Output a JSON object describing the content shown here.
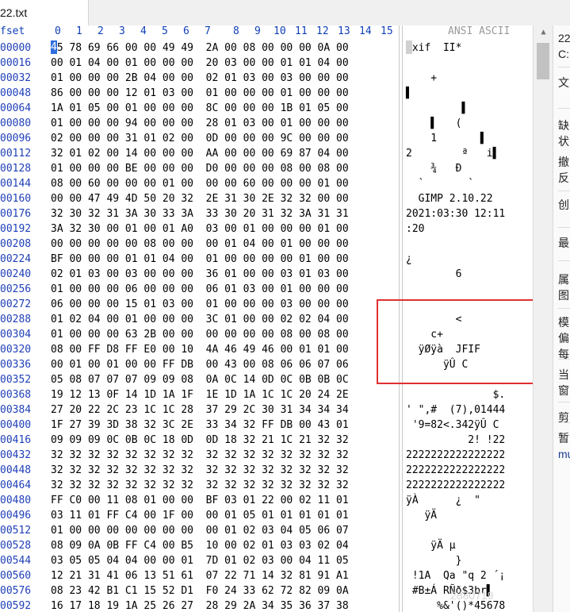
{
  "tab": {
    "title": "22.txt"
  },
  "header": {
    "offset_label": "fset",
    "columns": [
      "0",
      "1",
      "2",
      "3",
      "4",
      "5",
      "6",
      "7",
      "8",
      "9",
      "10",
      "11",
      "12",
      "13",
      "14",
      "15"
    ],
    "ascii_label": "ANSI ASCII"
  },
  "cursor": {
    "hex_digit": "4"
  },
  "rows": [
    {
      "offset": "00000",
      "bytes": "45 78 69 66 00 00 49 49  2A 00 08 00 00 00 0A 00",
      "ascii": "Exif  II*"
    },
    {
      "offset": "00016",
      "bytes": "00 01 04 00 01 00 00 00  20 03 00 00 01 01 04 00",
      "ascii": ""
    },
    {
      "offset": "00032",
      "bytes": "01 00 00 00 2B 04 00 00  02 01 03 00 03 00 00 00",
      "ascii": "    +"
    },
    {
      "offset": "00048",
      "bytes": "86 00 00 00 12 01 03 00  01 00 00 00 01 00 00 00",
      "ascii": "▌"
    },
    {
      "offset": "00064",
      "bytes": "1A 01 05 00 01 00 00 00  8C 00 00 00 1B 01 05 00",
      "ascii": "         ▌"
    },
    {
      "offset": "00080",
      "bytes": "01 00 00 00 94 00 00 00  28 01 03 00 01 00 00 00",
      "ascii": "    ▌   ("
    },
    {
      "offset": "00096",
      "bytes": "02 00 00 00 31 01 02 00  0D 00 00 00 9C 00 00 00",
      "ascii": "    1       ▌"
    },
    {
      "offset": "00112",
      "bytes": "32 01 02 00 14 00 00 00  AA 00 00 00 69 87 04 00",
      "ascii": "2        ª   i▌"
    },
    {
      "offset": "00128",
      "bytes": "01 00 00 00 BE 00 00 00  D0 00 00 00 08 00 08 00",
      "ascii": "    ¾   Ð"
    },
    {
      "offset": "00144",
      "bytes": "08 00 60 00 00 00 01 00  00 00 60 00 00 00 01 00",
      "ascii": "  `       `"
    },
    {
      "offset": "00160",
      "bytes": "00 00 47 49 4D 50 20 32  2E 31 30 2E 32 32 00 00",
      "ascii": "  GIMP 2.10.22"
    },
    {
      "offset": "00176",
      "bytes": "32 30 32 31 3A 30 33 3A  33 30 20 31 32 3A 31 31",
      "ascii": "2021:03:30 12:11"
    },
    {
      "offset": "00192",
      "bytes": "3A 32 30 00 01 00 01 A0  03 00 01 00 00 00 01 00",
      "ascii": ":20"
    },
    {
      "offset": "00208",
      "bytes": "00 00 00 00 00 08 00 00  00 01 04 00 01 00 00 00",
      "ascii": ""
    },
    {
      "offset": "00224",
      "bytes": "BF 00 00 00 01 01 04 00  01 00 00 00 00 01 00 00",
      "ascii": "¿"
    },
    {
      "offset": "00240",
      "bytes": "02 01 03 00 03 00 00 00  36 01 00 00 03 01 03 00",
      "ascii": "        6"
    },
    {
      "offset": "00256",
      "bytes": "01 00 00 00 06 00 00 00  06 01 03 00 01 00 00 00",
      "ascii": ""
    },
    {
      "offset": "00272",
      "bytes": "06 00 00 00 15 01 03 00  01 00 00 00 03 00 00 00",
      "ascii": ""
    },
    {
      "offset": "00288",
      "bytes": "01 02 04 00 01 00 00 00  3C 01 00 00 02 02 04 00",
      "ascii": "        <"
    },
    {
      "offset": "00304",
      "bytes": "01 00 00 00 63 2B 00 00  00 00 00 00 08 00 08 00",
      "ascii": "    c+"
    },
    {
      "offset": "00320",
      "bytes": "08 00 FF D8 FF E0 00 10  4A 46 49 46 00 01 01 00",
      "ascii": "  ÿØÿà  JFIF"
    },
    {
      "offset": "00336",
      "bytes": "00 01 00 01 00 00 FF DB  00 43 00 08 06 06 07 06",
      "ascii": "      ÿÛ C"
    },
    {
      "offset": "00352",
      "bytes": "05 08 07 07 07 09 09 08  0A 0C 14 0D 0C 0B 0B 0C",
      "ascii": ""
    },
    {
      "offset": "00368",
      "bytes": "19 12 13 0F 14 1D 1A 1F  1E 1D 1A 1C 1C 20 24 2E",
      "ascii": "              $."
    },
    {
      "offset": "00384",
      "bytes": "27 20 22 2C 23 1C 1C 28  37 29 2C 30 31 34 34 34",
      "ascii": "' \",#  (7),01444"
    },
    {
      "offset": "00400",
      "bytes": "1F 27 39 3D 38 32 3C 2E  33 34 32 FF DB 00 43 01",
      "ascii": " '9=82<.342ÿÛ C"
    },
    {
      "offset": "00416",
      "bytes": "09 09 09 0C 0B 0C 18 0D  0D 18 32 21 1C 21 32 32",
      "ascii": "          2! !22"
    },
    {
      "offset": "00432",
      "bytes": "32 32 32 32 32 32 32 32  32 32 32 32 32 32 32 32",
      "ascii": "2222222222222222"
    },
    {
      "offset": "00448",
      "bytes": "32 32 32 32 32 32 32 32  32 32 32 32 32 32 32 32",
      "ascii": "2222222222222222"
    },
    {
      "offset": "00464",
      "bytes": "32 32 32 32 32 32 32 32  32 32 32 32 32 32 32 32",
      "ascii": "2222222222222222"
    },
    {
      "offset": "00480",
      "bytes": "FF C0 00 11 08 01 00 00  BF 03 01 22 00 02 11 01",
      "ascii": "ÿÀ      ¿  \""
    },
    {
      "offset": "00496",
      "bytes": "03 11 01 FF C4 00 1F 00  00 01 05 01 01 01 01 01",
      "ascii": "   ÿÄ"
    },
    {
      "offset": "00512",
      "bytes": "01 00 00 00 00 00 00 00  00 01 02 03 04 05 06 07",
      "ascii": ""
    },
    {
      "offset": "00528",
      "bytes": "08 09 0A 0B FF C4 00 B5  10 00 02 01 03 03 02 04",
      "ascii": "    ÿÄ µ"
    },
    {
      "offset": "00544",
      "bytes": "03 05 05 04 04 00 00 01  7D 01 02 03 00 04 11 05",
      "ascii": "        }"
    },
    {
      "offset": "00560",
      "bytes": "12 21 31 41 06 13 51 61  07 22 71 14 32 81 91 A1",
      "ascii": " !1A  Qa \"q 2 ´¡"
    },
    {
      "offset": "00576",
      "bytes": "08 23 42 B1 C1 15 52 D1  F0 24 33 62 72 82 09 0A",
      "ascii": " #B±Á RÑð$3br▌"
    },
    {
      "offset": "00592",
      "bytes": "16 17 18 19 1A 25 26 27  28 29 2A 34 35 36 37 38",
      "ascii": "     %&'()*45678"
    }
  ],
  "side": {
    "items": [
      "22",
      "C:",
      "文",
      "缺",
      "状",
      "撤",
      "反",
      "创",
      "最",
      "属",
      "图",
      "模",
      "偏",
      "每",
      "当",
      "窗",
      "剪",
      "暂",
      "mu"
    ]
  },
  "watermark": "2880719"
}
